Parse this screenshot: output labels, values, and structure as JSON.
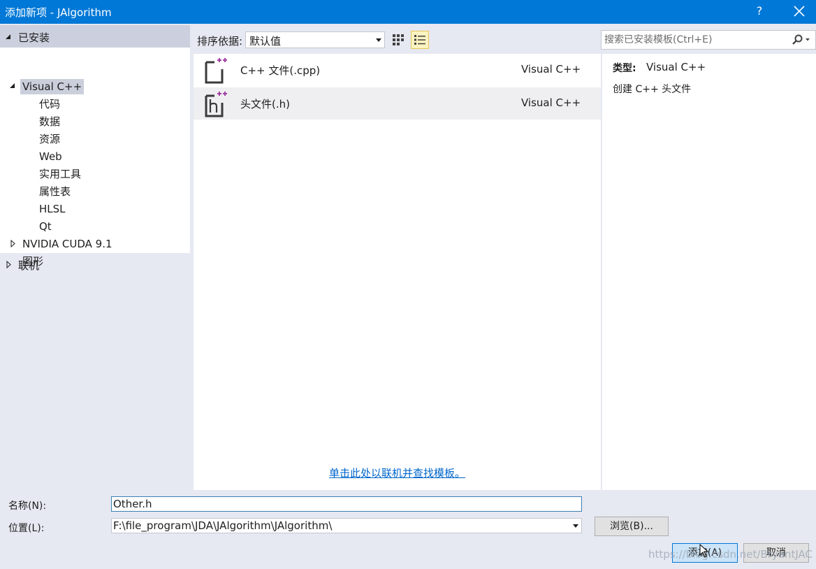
{
  "window": {
    "title": "添加新项 - JAlgorithm",
    "help": "?"
  },
  "sidebar": {
    "installed": "已安装",
    "tree": [
      {
        "label": "Visual C++"
      },
      {
        "label": "代码"
      },
      {
        "label": "数据"
      },
      {
        "label": "资源"
      },
      {
        "label": "Web"
      },
      {
        "label": "实用工具"
      },
      {
        "label": "属性表"
      },
      {
        "label": "HLSL"
      },
      {
        "label": "Qt"
      },
      {
        "label": "NVIDIA CUDA 9.1"
      },
      {
        "label": "图形"
      }
    ],
    "online": "联机"
  },
  "sort": {
    "label": "排序依据:",
    "value": "默认值"
  },
  "templates": [
    {
      "name": "C++ 文件(.cpp)",
      "lang": "Visual C++",
      "icon": "cpp-file-icon"
    },
    {
      "name": "头文件(.h)",
      "lang": "Visual C++",
      "icon": "header-file-icon"
    }
  ],
  "online_link": "单击此处以联机并查找模板。",
  "search": {
    "placeholder": "搜索已安装模板(Ctrl+E)"
  },
  "details": {
    "type_label": "类型:",
    "type_value": "Visual C++",
    "description": "创建 C++ 头文件"
  },
  "form": {
    "name_label": "名称(N):",
    "name_value": "Other.h",
    "location_label": "位置(L):",
    "location_value": "F:\\file_program\\JDA\\JAlgorithm\\JAlgorithm\\",
    "browse": "浏览(B)...",
    "add": "添加(A)",
    "cancel": "取消"
  },
  "watermark": "https://blog.csdn.net/BryantJAC",
  "colors": {
    "titlebar": "#0078d7",
    "link": "#0066cc",
    "selection": "#cbcfdc",
    "background": "#e6e8f2"
  }
}
